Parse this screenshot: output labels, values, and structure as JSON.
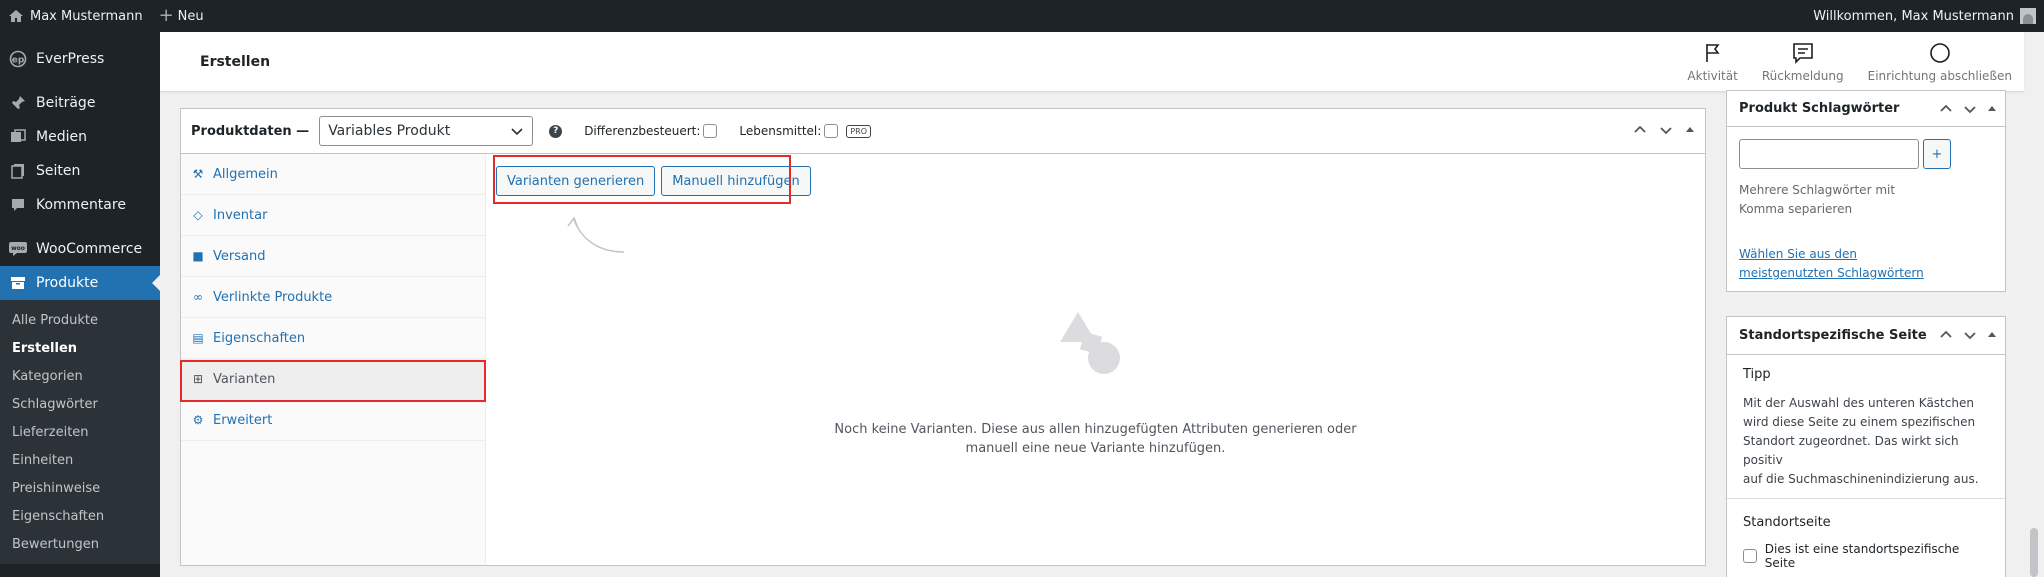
{
  "adminbar": {
    "site_name": "Max Mustermann",
    "new_label": "Neu",
    "greeting": "Willkommen, Max Mustermann"
  },
  "sidebar": {
    "brand": "EverPress",
    "items": [
      {
        "label": "Beiträge",
        "icon": "pin-icon"
      },
      {
        "label": "Medien",
        "icon": "media-icon"
      },
      {
        "label": "Seiten",
        "icon": "pages-icon"
      },
      {
        "label": "Kommentare",
        "icon": "comment-icon"
      },
      {
        "label": "WooCommerce",
        "icon": "woo-icon"
      },
      {
        "label": "Produkte",
        "icon": "archive-icon"
      }
    ],
    "submenu": [
      "Alle Produkte",
      "Erstellen",
      "Kategorien",
      "Schlagwörter",
      "Lieferzeiten",
      "Einheiten",
      "Preishinweise",
      "Eigenschaften",
      "Bewertungen"
    ]
  },
  "header": {
    "title": "Erstellen",
    "actions": [
      "Aktivität",
      "Rückmeldung",
      "Einrichtung abschließen"
    ]
  },
  "product_data": {
    "label": "Produktdaten —",
    "type_value": "Variables Produkt",
    "opt_taxed": "Differenzbesteuert:",
    "opt_food": "Lebensmittel:",
    "pro_badge": "PRO",
    "tabs": [
      "Allgemein",
      "Inventar",
      "Versand",
      "Verlinkte Produkte",
      "Eigenschaften",
      "Varianten",
      "Erweitert"
    ],
    "generate_button": "Varianten generieren",
    "manual_button": "Manuell hinzufügen",
    "empty_line1": "Noch keine Varianten. Diese aus allen hinzugefügten Attributen generieren oder",
    "empty_line2": "manuell eine neue Variante hinzufügen."
  },
  "tags_box": {
    "title": "Produkt Schlagwörter",
    "add_label": "+",
    "hint_line1": "Mehrere Schlagwörter mit",
    "hint_line2": "Komma separieren",
    "link_line1": "Wählen Sie aus den",
    "link_line2": "meistgenutzten Schlagwörtern"
  },
  "location_box": {
    "title": "Standortspezifische Seite",
    "tip_title": "Tipp",
    "tip_lines": [
      "Mit der Auswahl des unteren Kästchen",
      "wird diese Seite zu einem spezifischen",
      "Standort zugeordnet. Das wirkt sich positiv",
      "auf die Suchmaschinenindizierung aus."
    ],
    "section_title": "Standortseite",
    "checkbox_label": "Dies ist eine standortspezifische Seite"
  }
}
